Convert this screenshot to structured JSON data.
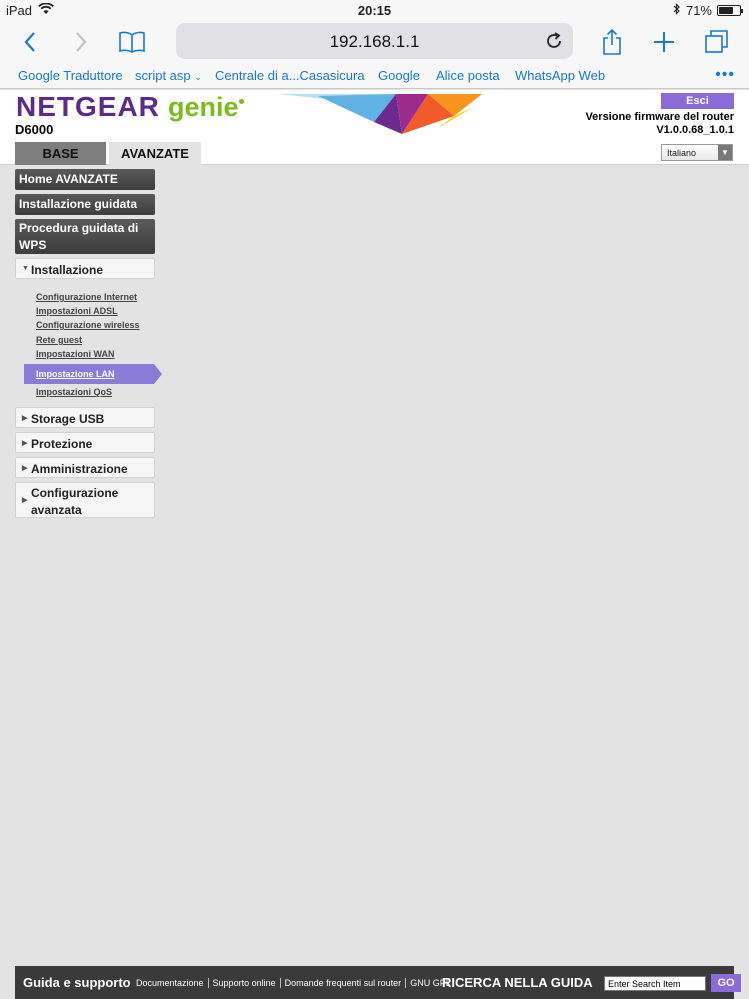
{
  "status_bar": {
    "device": "iPad",
    "time": "20:15",
    "battery": "71%",
    "battery_level": 0.71
  },
  "browser": {
    "url": "192.168.1.1",
    "icons": [
      "back-icon",
      "forward-icon",
      "bookmarks-book-icon",
      "reload-icon",
      "share-icon",
      "new-tab-plus-icon",
      "tabs-icon"
    ],
    "bookmarks": [
      "Google Traduttore",
      "script asp",
      "Centrale di a...Casasicura",
      "Google",
      "Alice posta",
      "WhatsApp Web"
    ],
    "more": "•••"
  },
  "router": {
    "brand": "NETGEAR",
    "genie": "genie",
    "model": "D6000",
    "logout": "Esci",
    "fw_label": "Versione firmware del router",
    "fw_version": "V1.0.0.68_1.0.1",
    "tabs": {
      "base": "BASE",
      "advanced": "AVANZATE"
    },
    "language": "Italiano",
    "colors": {
      "brand_purple": "#5a2b8a",
      "genie_green": "#7cbb1f",
      "accent": "#8a6bd9"
    }
  },
  "menu": {
    "home": "Home AVANZATE",
    "wizard": "Installazione guidata",
    "wps": "Procedura guidata di WPS",
    "setup": "Installazione",
    "setup_items": [
      "Configurazione Internet",
      "Impostazioni ADSL",
      "Configurazione wireless",
      "Rete guest",
      "Impostazioni WAN",
      "Impostazione LAN",
      "Impostazioni QoS"
    ],
    "active_item": "Impostazione LAN",
    "usb": "Storage USB",
    "security": "Protezione",
    "admin": "Amministrazione",
    "advanced_setup": "Configurazione avanzata"
  },
  "footer": {
    "help_title": "Guida e supporto",
    "links": [
      "Documentazione",
      "Supporto online",
      "Domande frequenti sul router",
      "GNU GPL"
    ],
    "search_title": "RICERCA NELLA GUIDA",
    "search_placeholder": "Enter Search Item",
    "go": "GO"
  }
}
